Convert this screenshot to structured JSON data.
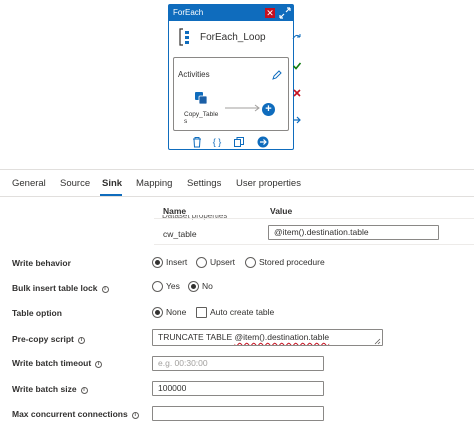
{
  "activity": {
    "header": "ForEach",
    "name": "ForEach_Loop",
    "inner_label": "Activities",
    "child_label": "Copy_Tables",
    "colors": {
      "accent": "#0f6cbd",
      "close": "#c50f1f",
      "success": "#107c10"
    },
    "icons": [
      "close-icon",
      "expand-icon",
      "foreach-icon",
      "edit-icon",
      "copy-activity-icon",
      "add-icon",
      "delete-icon",
      "code-icon",
      "clone-icon",
      "go-icon"
    ],
    "side_icons": [
      "skip-icon",
      "success-icon",
      "failure-icon",
      "completion-icon"
    ]
  },
  "tabs": [
    {
      "label": "General"
    },
    {
      "label": "Source"
    },
    {
      "label": "Sink",
      "active": true
    },
    {
      "label": "Mapping"
    },
    {
      "label": "Settings"
    },
    {
      "label": "User properties"
    }
  ],
  "dataset": {
    "caption": "Dataset properties",
    "col_name": "Name",
    "col_value": "Value",
    "rows": [
      {
        "name": "cw_table",
        "value": "@item().destination.table"
      }
    ]
  },
  "form": {
    "write_behavior": {
      "label": "Write behavior",
      "options": [
        "Insert",
        "Upsert",
        "Stored procedure"
      ],
      "selected": "Insert"
    },
    "bulk_insert": {
      "label": "Bulk insert table lock",
      "options": [
        "Yes",
        "No"
      ],
      "selected": "No"
    },
    "table_option": {
      "label": "Table option",
      "options": [
        "None",
        "Auto create table"
      ],
      "selected": "None"
    },
    "pre_copy": {
      "label": "Pre-copy script",
      "value_prefix": "TRUNCATE TABLE ",
      "value_main": "@item().destination.table"
    },
    "timeout": {
      "label": "Write batch timeout",
      "placeholder": "e.g. 00:30:00"
    },
    "batch_size": {
      "label": "Write batch size",
      "value": "100000"
    },
    "max_conn": {
      "label": "Max concurrent connections",
      "value": ""
    }
  }
}
